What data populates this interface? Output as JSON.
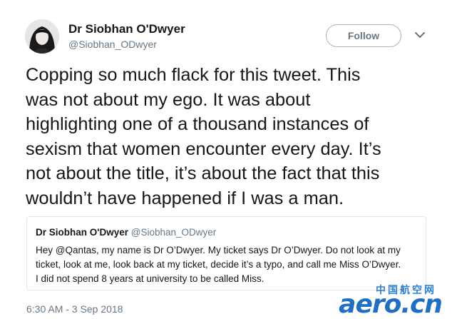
{
  "tweet": {
    "display_name": "Dr Siobhan O'Dwyer",
    "handle": "@Siobhan_ODwyer",
    "follow_label": "Follow",
    "text_lines": [
      "Copping so much flack for this tweet. This",
      "was not about my ego. It was about",
      "highlighting one of a thousand instances of",
      "sexism that women encounter every day. It’s",
      "not about the title, it’s about the fact that this",
      "wouldn’t have happened if I was a man."
    ],
    "timestamp": "6:30 AM - 3 Sep 2018"
  },
  "quoted_tweet": {
    "display_name": "Dr Siobhan O'Dwyer",
    "handle": "@Siobhan_ODwyer",
    "text_lines": [
      "Hey @Qantas, my name is Dr O’Dwyer. My ticket says Dr O’Dwyer. Do not look at my",
      "ticket, look at me, look back at my ticket, decide it’s a typo, and call me Miss O’Dwyer.",
      "I did not spend 8 years at university to be called Miss."
    ]
  },
  "watermark": {
    "chinese": "中国航空网",
    "latin": "aero.cn"
  },
  "icons": {
    "caret": "chevron-down-icon",
    "avatar": "avatar"
  },
  "colors": {
    "text": "#14171a",
    "secondary": "#657786",
    "border": "#e1e8ed",
    "watermark": "#1f6fc4"
  }
}
